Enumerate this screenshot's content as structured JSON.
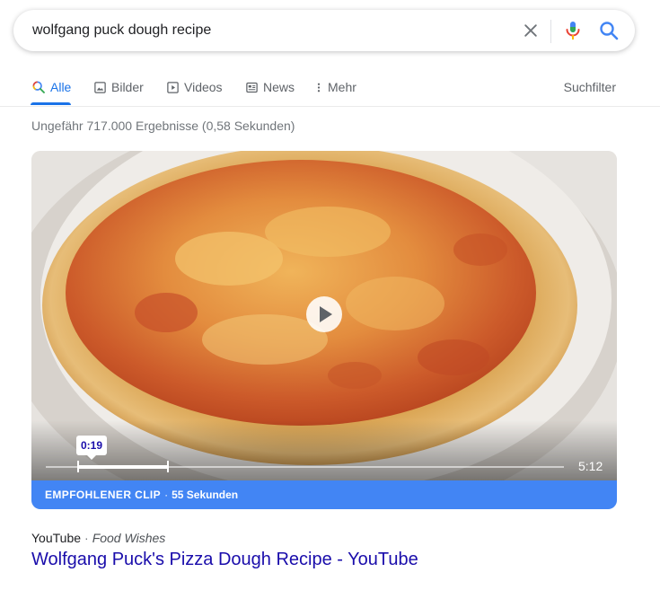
{
  "search": {
    "query": "wolfgang puck dough recipe"
  },
  "icons": {
    "clear": "close-icon",
    "mic": "microphone-icon",
    "search": "search-icon",
    "images": "image-icon",
    "videos": "play-box-icon",
    "news": "newspaper-icon",
    "more": "more-vertical-icon",
    "play": "play-icon"
  },
  "colors": {
    "accent": "#1a73e8",
    "link": "#1a0dab",
    "banner": "#4285f4",
    "muted": "#70757a"
  },
  "tabs": [
    {
      "label": "Alle",
      "active": true
    },
    {
      "label": "Bilder"
    },
    {
      "label": "Videos"
    },
    {
      "label": "News"
    },
    {
      "label": "Mehr"
    }
  ],
  "search_filter": "Suchfilter",
  "result_stats": "Ungefähr 717.000 Ergebnisse (0,58 Sekunden)",
  "video": {
    "clip_start": "0:19",
    "duration": "5:12",
    "clip_label": "EMPFOHLENER CLIP",
    "separator": "·",
    "clip_length": "55 Sekunden"
  },
  "result": {
    "source": "YouTube",
    "separator": "·",
    "channel": "Food Wishes",
    "title": "Wolfgang Puck's Pizza Dough Recipe - YouTube"
  }
}
